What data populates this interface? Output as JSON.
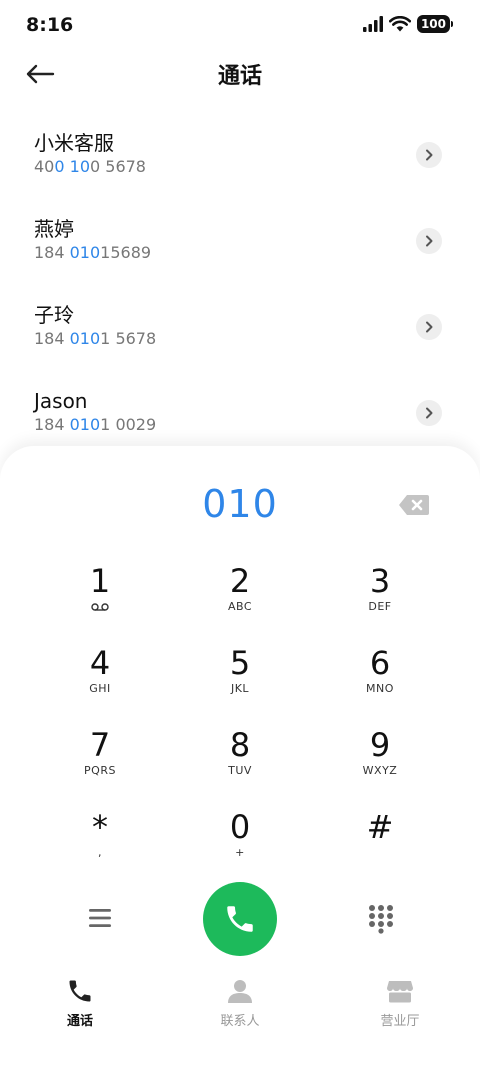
{
  "status_bar": {
    "time": "8:16",
    "battery": "100"
  },
  "header": {
    "title": "通话"
  },
  "contacts": [
    {
      "name": "小米客服",
      "number_parts": [
        {
          "text": "40",
          "match": false
        },
        {
          "text": "0",
          "match": true
        },
        {
          "text": " ",
          "match": false
        },
        {
          "text": "10",
          "match": true
        },
        {
          "text": "0 5678",
          "match": false
        }
      ]
    },
    {
      "name": "燕婷",
      "number_parts": [
        {
          "text": "184 ",
          "match": false
        },
        {
          "text": "010",
          "match": true
        },
        {
          "text": "15689",
          "match": false
        }
      ]
    },
    {
      "name": "子玲",
      "number_parts": [
        {
          "text": "184 ",
          "match": false
        },
        {
          "text": "010",
          "match": true
        },
        {
          "text": "1 5678",
          "match": false
        }
      ]
    },
    {
      "name": "Jason",
      "number_parts": [
        {
          "text": "184 ",
          "match": false
        },
        {
          "text": "010",
          "match": true
        },
        {
          "text": "1 0029",
          "match": false
        }
      ]
    }
  ],
  "dialer": {
    "display": "010",
    "keys": [
      [
        {
          "digit": "1",
          "sub": ""
        },
        {
          "digit": "2",
          "sub": "ABC"
        },
        {
          "digit": "3",
          "sub": "DEF"
        }
      ],
      [
        {
          "digit": "4",
          "sub": "GHI"
        },
        {
          "digit": "5",
          "sub": "JKL"
        },
        {
          "digit": "6",
          "sub": "MNO"
        }
      ],
      [
        {
          "digit": "7",
          "sub": "PQRS"
        },
        {
          "digit": "8",
          "sub": "TUV"
        },
        {
          "digit": "9",
          "sub": "WXYZ"
        }
      ],
      [
        {
          "digit": "*",
          "sub": ","
        },
        {
          "digit": "0",
          "sub": "+"
        },
        {
          "digit": "#",
          "sub": ""
        }
      ]
    ]
  },
  "colors": {
    "accent": "#2f86e8",
    "call_green": "#1dba5b"
  },
  "bottom_nav": [
    {
      "label": "通话",
      "icon": "phone-icon",
      "active": true
    },
    {
      "label": "联系人",
      "icon": "person-icon",
      "active": false
    },
    {
      "label": "营业厅",
      "icon": "store-icon",
      "active": false
    }
  ]
}
